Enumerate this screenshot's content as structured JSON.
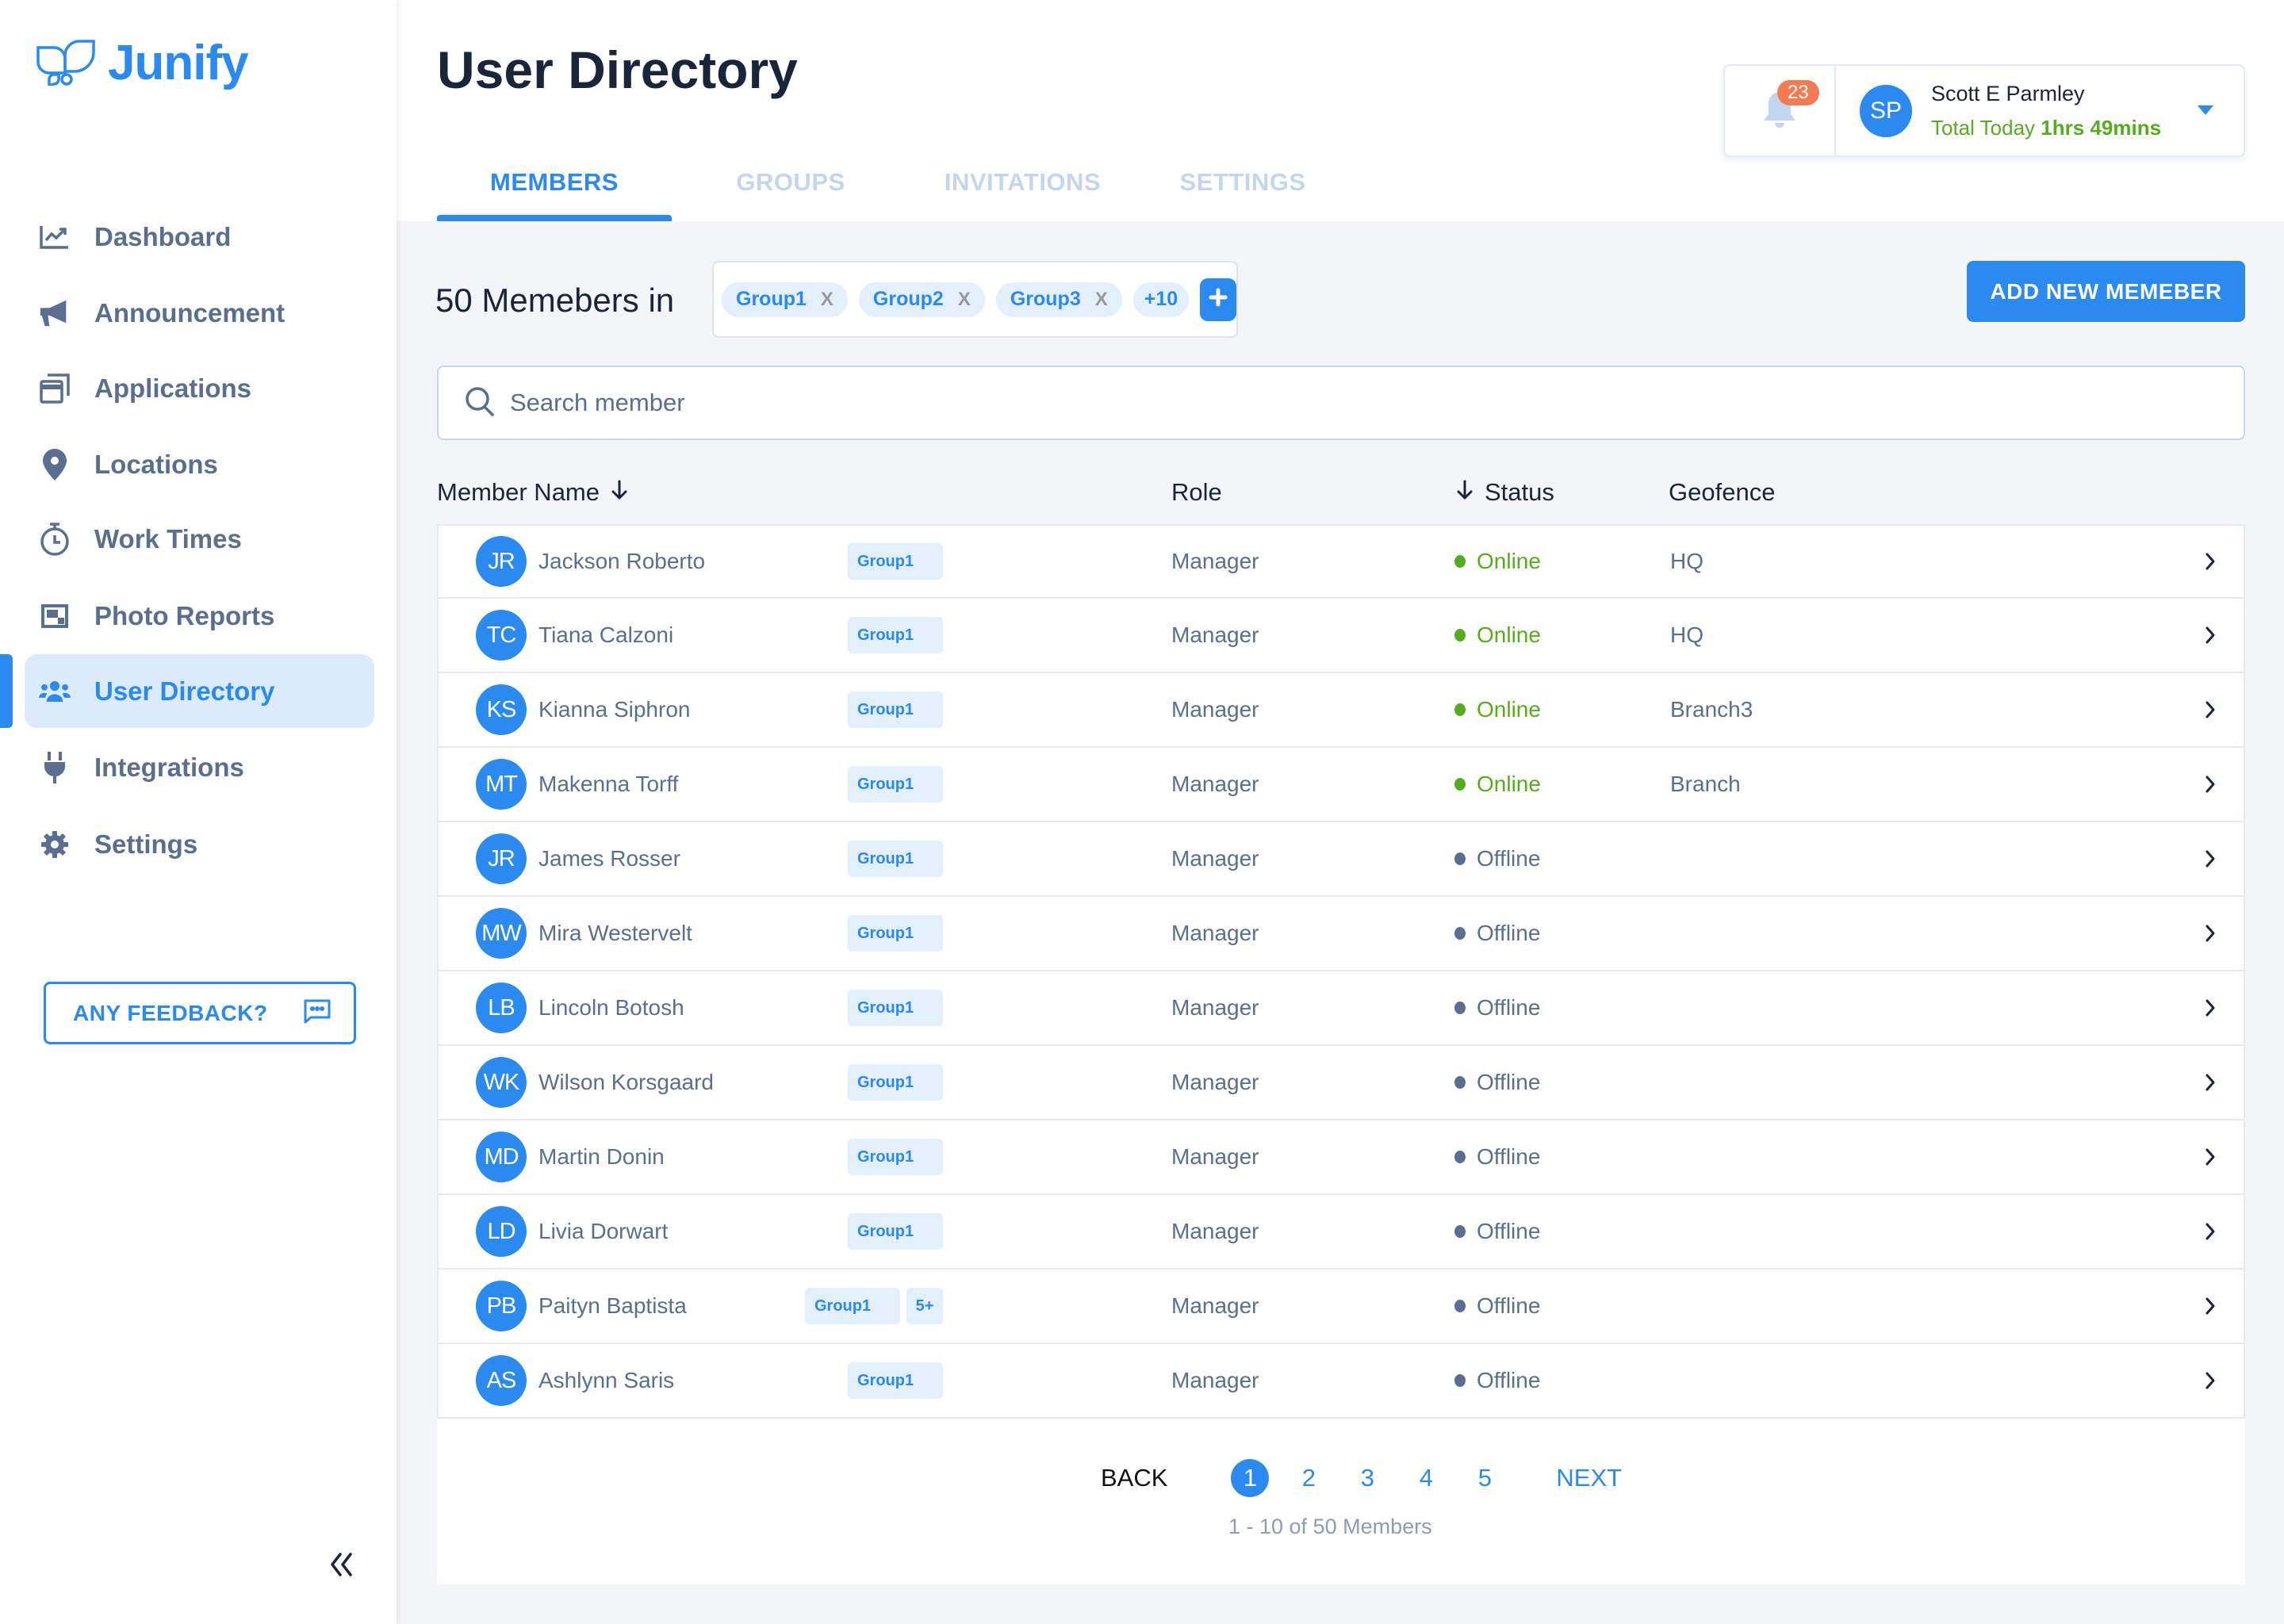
{
  "app": {
    "name": "Junify",
    "brand_color": "#2a8af0"
  },
  "sidebar": {
    "items": [
      {
        "label": "Dashboard",
        "icon": "chart-line-icon",
        "active": false
      },
      {
        "label": "Announcement",
        "icon": "megaphone-icon",
        "active": false
      },
      {
        "label": "Applications",
        "icon": "windows-icon",
        "active": false
      },
      {
        "label": "Locations",
        "icon": "map-pin-icon",
        "active": false
      },
      {
        "label": "Work Times",
        "icon": "stopwatch-icon",
        "active": false
      },
      {
        "label": "Photo Reports",
        "icon": "photo-frame-icon",
        "active": false
      },
      {
        "label": "User Directory",
        "icon": "users-icon",
        "active": true
      },
      {
        "label": "Integrations",
        "icon": "plug-icon",
        "active": false
      },
      {
        "label": "Settings",
        "icon": "gear-icon",
        "active": false
      }
    ],
    "feedback_label": "ANY FEEDBACK?",
    "collapse_icon": "double-chevron-left-icon"
  },
  "header": {
    "title": "User Directory",
    "tabs": [
      {
        "label": "MEMBERS",
        "active": true
      },
      {
        "label": "GROUPS",
        "active": false
      },
      {
        "label": "INVITATIONS",
        "active": false
      },
      {
        "label": "SETTINGS",
        "active": false
      }
    ],
    "notifications_count": "23",
    "user": {
      "initials": "SP",
      "name": "Scott E Parmley",
      "time_label": "Total Today",
      "time_value": "1hrs 49mins"
    }
  },
  "filters": {
    "members_count_label": "50 Memebers in",
    "chips": [
      {
        "label": "Group1",
        "remove": "X"
      },
      {
        "label": "Group2",
        "remove": "X"
      },
      {
        "label": "Group3",
        "remove": "X"
      }
    ],
    "more_chip": "+10",
    "add_button_label": "ADD NEW MEMEBER",
    "search_placeholder": "Search member",
    "search_value": ""
  },
  "table": {
    "columns": {
      "name": "Member Name",
      "role": "Role",
      "status": "Status",
      "geofence": "Geofence"
    },
    "status_colors": {
      "Online": "#55ad1d",
      "Offline": "#5a6f8f"
    },
    "rows": [
      {
        "initials": "JR",
        "name": "Jackson Roberto",
        "groups": [
          "Group1"
        ],
        "extra": "",
        "role": "Manager",
        "status": "Online",
        "geofence": "HQ"
      },
      {
        "initials": "TC",
        "name": "Tiana Calzoni",
        "groups": [
          "Group1"
        ],
        "extra": "",
        "role": "Manager",
        "status": "Online",
        "geofence": "HQ"
      },
      {
        "initials": "KS",
        "name": "Kianna Siphron",
        "groups": [
          "Group1"
        ],
        "extra": "",
        "role": "Manager",
        "status": "Online",
        "geofence": "Branch3"
      },
      {
        "initials": "MT",
        "name": "Makenna Torff",
        "groups": [
          "Group1"
        ],
        "extra": "",
        "role": "Manager",
        "status": "Online",
        "geofence": "Branch"
      },
      {
        "initials": "JR",
        "name": "James Rosser",
        "groups": [
          "Group1"
        ],
        "extra": "",
        "role": "Manager",
        "status": "Offline",
        "geofence": ""
      },
      {
        "initials": "MW",
        "name": "Mira Westervelt",
        "groups": [
          "Group1"
        ],
        "extra": "",
        "role": "Manager",
        "status": "Offline",
        "geofence": ""
      },
      {
        "initials": "LB",
        "name": "Lincoln Botosh",
        "groups": [
          "Group1"
        ],
        "extra": "",
        "role": "Manager",
        "status": "Offline",
        "geofence": ""
      },
      {
        "initials": "WK",
        "name": "Wilson Korsgaard",
        "groups": [
          "Group1"
        ],
        "extra": "",
        "role": "Manager",
        "status": "Offline",
        "geofence": ""
      },
      {
        "initials": "MD",
        "name": "Martin Donin",
        "groups": [
          "Group1"
        ],
        "extra": "",
        "role": "Manager",
        "status": "Offline",
        "geofence": ""
      },
      {
        "initials": "LD",
        "name": "Livia Dorwart",
        "groups": [
          "Group1"
        ],
        "extra": "",
        "role": "Manager",
        "status": "Offline",
        "geofence": ""
      },
      {
        "initials": "PB",
        "name": "Paityn Baptista",
        "groups": [
          "Group1"
        ],
        "extra": "5+",
        "role": "Manager",
        "status": "Offline",
        "geofence": ""
      },
      {
        "initials": "AS",
        "name": "Ashlynn Saris",
        "groups": [
          "Group1"
        ],
        "extra": "",
        "role": "Manager",
        "status": "Offline",
        "geofence": ""
      }
    ]
  },
  "pagination": {
    "back_label": "BACK",
    "next_label": "NEXT",
    "pages": [
      "1",
      "2",
      "3",
      "4",
      "5"
    ],
    "current_page": "1",
    "summary": "1 - 10 of 50 Members"
  }
}
